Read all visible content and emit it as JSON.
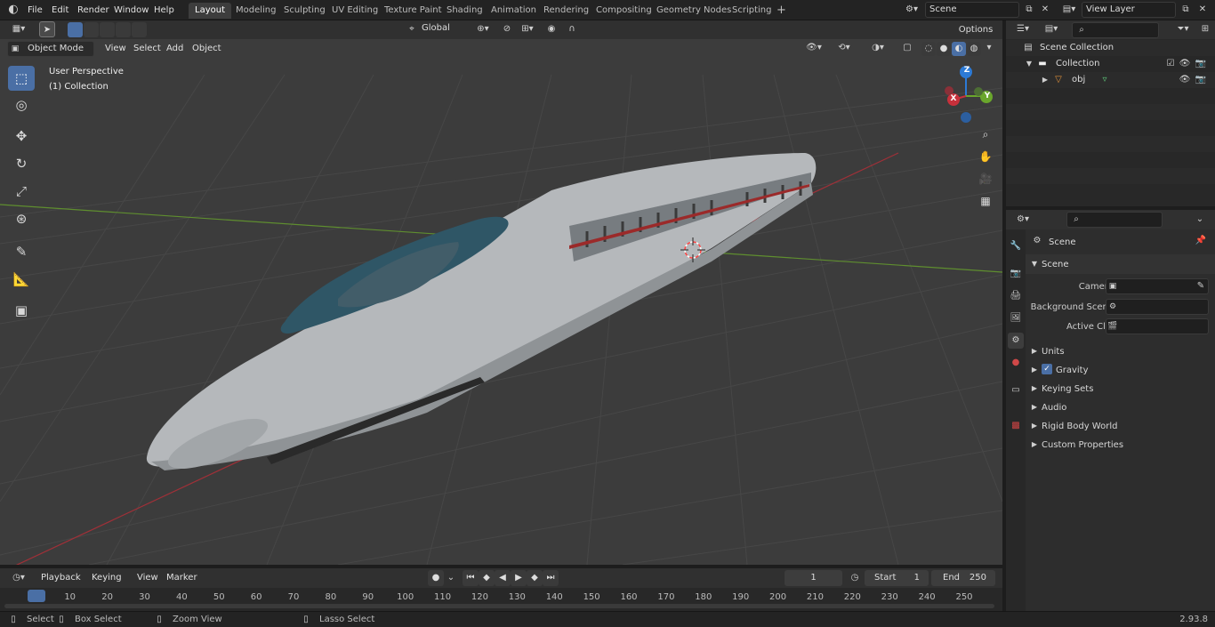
{
  "topbar": {
    "menus": [
      "File",
      "Edit",
      "Render",
      "Window",
      "Help"
    ],
    "workspaces": [
      "Layout",
      "Modeling",
      "Sculpting",
      "UV Editing",
      "Texture Paint",
      "Shading",
      "Animation",
      "Rendering",
      "Compositing",
      "Geometry Nodes",
      "Scripting"
    ],
    "active_workspace": "Layout",
    "scene_name": "Scene",
    "view_layer": "View Layer",
    "add_tab": "+"
  },
  "viewport_header": {
    "mode": "Object Mode",
    "menus": [
      "View",
      "Select",
      "Add",
      "Object"
    ],
    "orientation": "Global",
    "options": "Options"
  },
  "viewport": {
    "perspective_label": "User Perspective",
    "collection_label": "(1) Collection",
    "gizmo_axes": {
      "x": "X",
      "y": "Y",
      "z": "Z"
    },
    "colors": {
      "x_axis": "#c8303b",
      "y_axis": "#6aa62c",
      "z_axis": "#2c7ad6",
      "grid": "#464646",
      "background": "#3c3c3c"
    }
  },
  "outliner": {
    "root": "Scene Collection",
    "collection": "Collection",
    "object": "obj"
  },
  "properties": {
    "header_title": "Scene",
    "section": "Scene",
    "fields": [
      {
        "label": "Camera",
        "value": ""
      },
      {
        "label": "Background Scene",
        "value": ""
      },
      {
        "label": "Active Clip",
        "value": ""
      }
    ],
    "panels": [
      "Units",
      "Gravity",
      "Keying Sets",
      "Audio",
      "Rigid Body World",
      "Custom Properties"
    ]
  },
  "timeline": {
    "menus": [
      "Playback",
      "Keying",
      "View",
      "Marker"
    ],
    "current_frame": "1",
    "start_label": "Start",
    "start_value": "1",
    "end_label": "End",
    "end_value": "250",
    "ruler": [
      "1",
      "10",
      "20",
      "30",
      "40",
      "50",
      "60",
      "70",
      "80",
      "90",
      "100",
      "110",
      "120",
      "130",
      "140",
      "150",
      "160",
      "170",
      "180",
      "190",
      "200",
      "210",
      "220",
      "230",
      "240",
      "250"
    ]
  },
  "statusbar": {
    "items": [
      "Select",
      "Box Select",
      "Zoom View",
      "Lasso Select"
    ],
    "version": "2.93.8"
  }
}
